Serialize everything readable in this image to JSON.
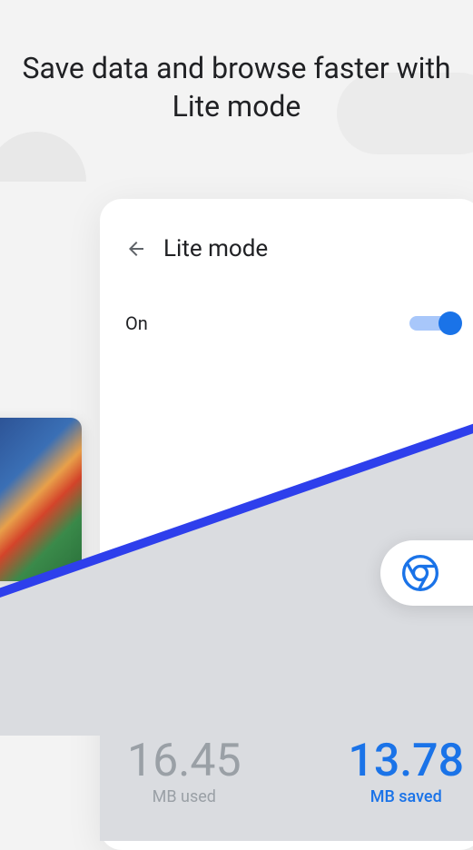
{
  "headline": "Save data and browse faster with Lite mode",
  "screen": {
    "title": "Lite mode",
    "toggle_label": "On"
  },
  "stats": {
    "used_value": "16.45",
    "used_label": "MB used",
    "saved_value": "13.78",
    "saved_label": "MB saved"
  }
}
